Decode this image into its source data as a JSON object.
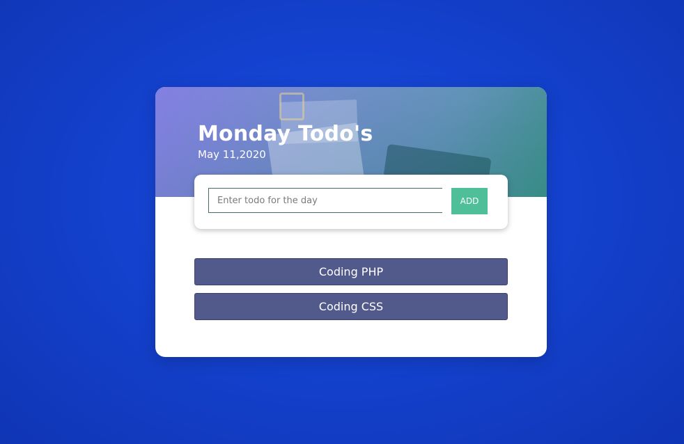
{
  "header": {
    "title": "Monday Todo's",
    "date": "May 11,2020"
  },
  "form": {
    "input_placeholder": "Enter todo for the day",
    "input_value": "",
    "add_label": "ADD"
  },
  "todos": [
    {
      "label": "Coding PHP"
    },
    {
      "label": "Coding CSS"
    }
  ],
  "colors": {
    "background": "#1442cf",
    "add_button": "#4fbf9a",
    "todo_item": "#525a8c"
  }
}
